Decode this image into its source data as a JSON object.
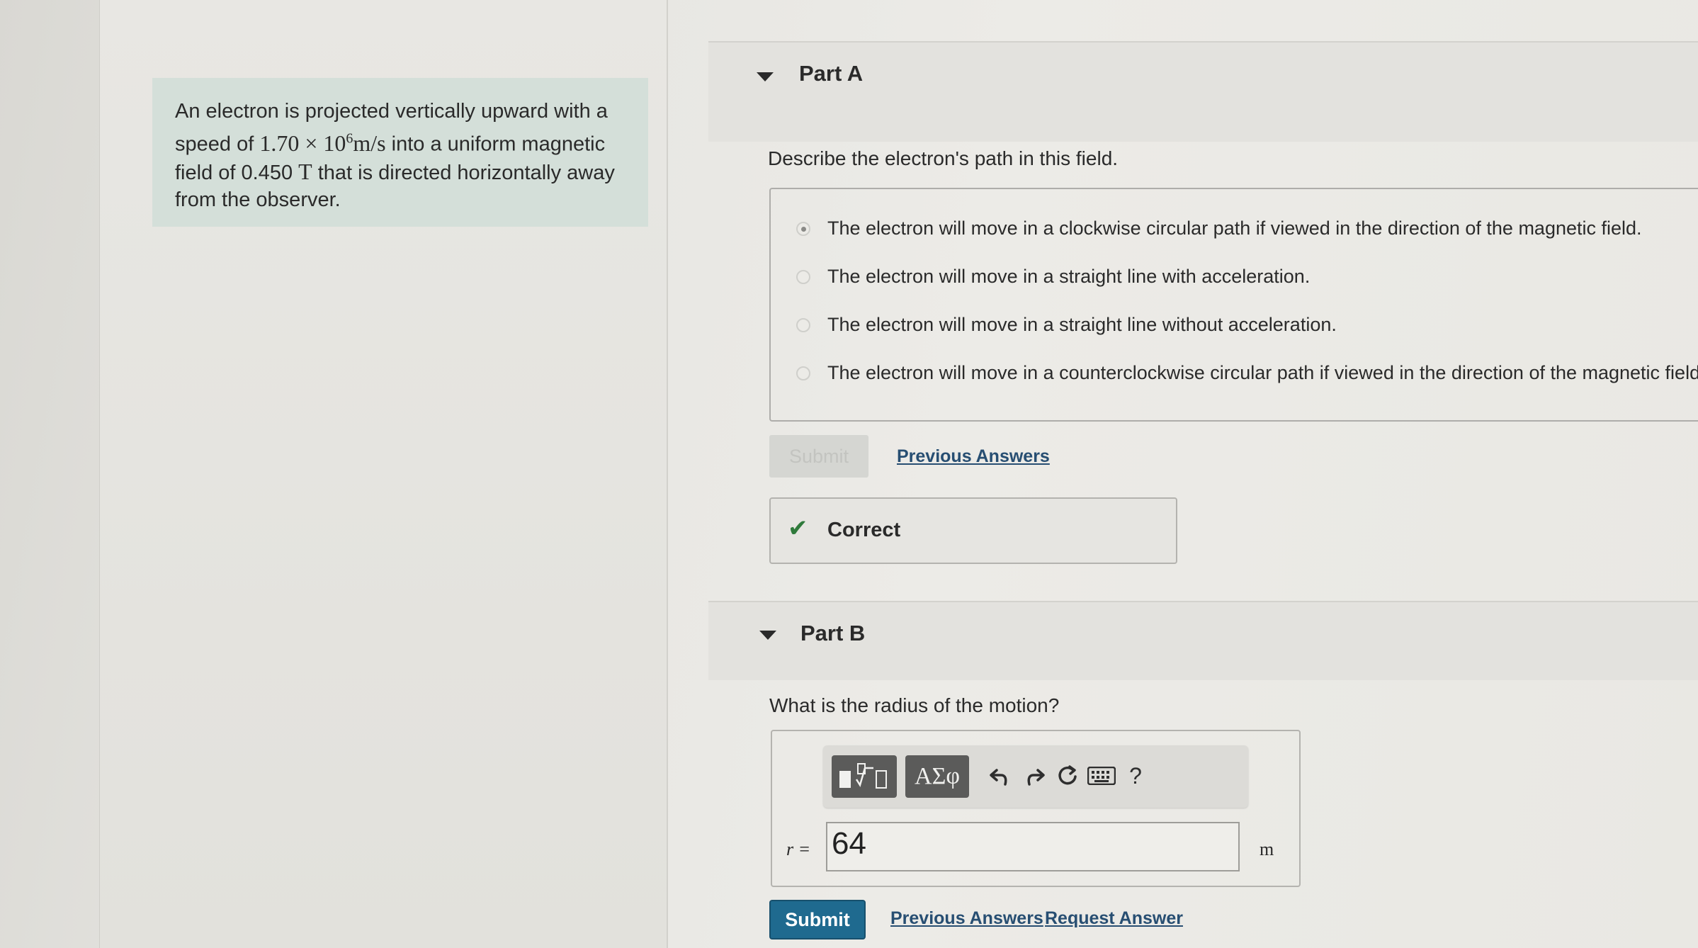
{
  "intro": {
    "line1": "An electron is projected vertically upward with a",
    "line2_pre": "speed of ",
    "line2_math": "1.70 × 10",
    "line2_exp": "6",
    "line2_unit": "m/s",
    "line2_post": " into a uniform magnetic",
    "line3_pre": "field of 0.450 ",
    "line3_unit": "T",
    "line3_post": " that is directed horizontally away",
    "line4": "from the observer."
  },
  "partA": {
    "title": "Part A",
    "question": "Describe the electron's path in this field.",
    "choices": [
      {
        "label": "The electron will move in a clockwise circular path if viewed in the direction of the magnetic field.",
        "selected": true
      },
      {
        "label": "The electron will move in a straight line with acceleration.",
        "selected": false
      },
      {
        "label": "The electron will move in a straight line without acceleration.",
        "selected": false
      },
      {
        "label": "The electron will move in a counterclockwise circular path if viewed in the direction of the magnetic field.",
        "selected": false
      }
    ],
    "submit_label": "Submit",
    "previous_answers_label": "Previous Answers",
    "feedback": "Correct"
  },
  "partB": {
    "title": "Part B",
    "question": "What is the radius of the motion?",
    "toolbar": {
      "greek_label": "ΑΣφ",
      "help_label": "?"
    },
    "variable_label": "r =",
    "answer_value": "64",
    "unit": "m",
    "submit_label": "Submit",
    "previous_answers_label": "Previous Answers",
    "request_answer_label": "Request Answer"
  },
  "colors": {
    "submit_blue": "#1f6a8f",
    "link": "#274e72",
    "check_green": "#2f7a3b",
    "intro_bg": "#d4dfd9"
  }
}
